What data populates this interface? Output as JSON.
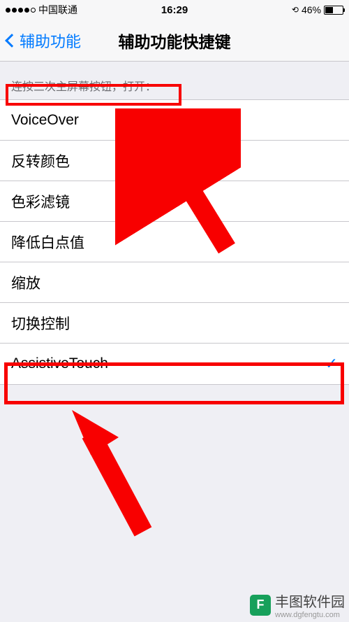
{
  "status": {
    "carrier": "中国联通",
    "time": "16:29",
    "battery_pct": "46%"
  },
  "nav": {
    "back_label": "辅助功能",
    "title": "辅助功能快捷键"
  },
  "section": {
    "header": "连按三次主屏幕按钮，打开："
  },
  "items": [
    {
      "label": "VoiceOver",
      "checked": false
    },
    {
      "label": "反转颜色",
      "checked": false
    },
    {
      "label": "色彩滤镜",
      "checked": false
    },
    {
      "label": "降低白点值",
      "checked": false
    },
    {
      "label": "缩放",
      "checked": false
    },
    {
      "label": "切换控制",
      "checked": false
    },
    {
      "label": "AssistiveTouch",
      "checked": true
    }
  ],
  "watermark": {
    "name": "丰图软件园",
    "url": "www.dgfengtu.com"
  },
  "annotations": {
    "arrow_color": "#f80000"
  }
}
